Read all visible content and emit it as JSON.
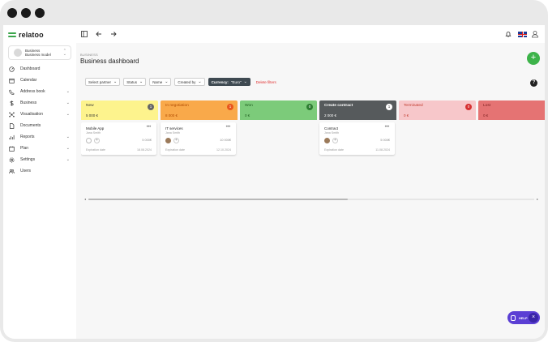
{
  "brand": {
    "name": "relatoo",
    "accent": "#3db34a"
  },
  "workspace": {
    "line1": "Business",
    "line2": "Business model"
  },
  "sidebar": {
    "items": [
      {
        "label": "Dashboard",
        "icon": "dashboard-icon"
      },
      {
        "label": "Calendar",
        "icon": "calendar-icon"
      },
      {
        "label": "Address book",
        "icon": "address-book-icon",
        "expandable": true
      },
      {
        "label": "Business",
        "icon": "dollar-icon",
        "expandable": true
      },
      {
        "label": "Visualisation",
        "icon": "visualisation-icon",
        "expandable": true
      },
      {
        "label": "Documents",
        "icon": "document-icon"
      },
      {
        "label": "Reports",
        "icon": "reports-icon",
        "expandable": true
      },
      {
        "label": "Plan",
        "icon": "plan-icon",
        "expandable": true
      },
      {
        "label": "Settings",
        "icon": "gear-icon",
        "expandable": true
      },
      {
        "label": "Users",
        "icon": "users-icon"
      }
    ]
  },
  "header": {
    "breadcrumb": "BUSINESS",
    "title": "Business dashboard"
  },
  "filters": {
    "items": [
      {
        "label": "Select partner"
      },
      {
        "label": "Status"
      },
      {
        "label": "Name"
      },
      {
        "label": "Created by"
      }
    ],
    "currency": {
      "label": "Currency:",
      "value": "\"Euro\""
    },
    "delete_label": "Delete filters"
  },
  "columns": [
    {
      "name": "New",
      "count": "1",
      "amount": "5 000 €",
      "bg": "#fdf38d",
      "text": "#333333",
      "badge": "#666666",
      "cards": [
        {
          "title": "Mobile App",
          "subtitle": "Jana Smith",
          "value": "5 000€",
          "expiry_label": "Expiration date",
          "expiry": "18.08.2024",
          "avatar": "empty"
        }
      ]
    },
    {
      "name": "In negotiation",
      "count": "1",
      "amount": "8 000 €",
      "bg": "#f9a94a",
      "text": "#b04a00",
      "badge": "#e8561e",
      "cards": [
        {
          "title": "IT services",
          "subtitle": "Jana Smith",
          "value": "10 000€",
          "expiry_label": "Expiration date",
          "expiry": "12.10.2024",
          "avatar": "photo"
        }
      ]
    },
    {
      "name": "Won",
      "count": "0",
      "amount": "0 €",
      "bg": "#7ccb7a",
      "text": "#1e5c1e",
      "badge": "#2e7d32",
      "cards": []
    },
    {
      "name": "Create contract",
      "count": "1",
      "amount": "2 000 €",
      "bg": "#565a5c",
      "text": "#ffffff",
      "badge": "#ffffff",
      "cards": [
        {
          "title": "Contract",
          "subtitle": "Jana Smith",
          "value": "5 000€",
          "expiry_label": "Expiration date",
          "expiry": "11.08.2024",
          "avatar": "photo"
        }
      ]
    },
    {
      "name": "Terminated",
      "count": "0",
      "amount": "0 €",
      "bg": "#f7c7ca",
      "text": "#c0392b",
      "badge": "#d63031",
      "cards": []
    },
    {
      "name": "Lost",
      "count": "0",
      "amount": "0 €",
      "bg": "#e57373",
      "text": "#7a1f1f",
      "badge": "#b71c1c",
      "cards": []
    }
  ],
  "help": {
    "label": "HELP"
  }
}
